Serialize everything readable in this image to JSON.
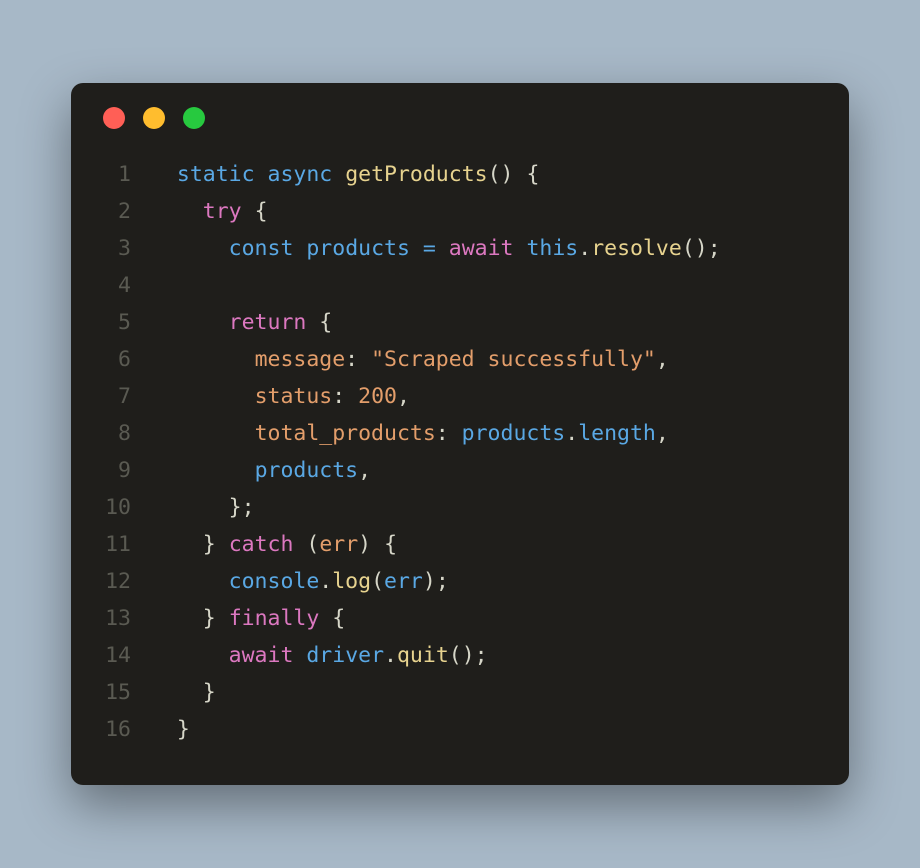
{
  "window": {
    "traffic_lights": [
      "red",
      "yellow",
      "green"
    ]
  },
  "code": {
    "lines": [
      {
        "n": "1",
        "tokens": [
          {
            "t": "  ",
            "c": "brace"
          },
          {
            "t": "static",
            "c": "kw-blue"
          },
          {
            "t": " ",
            "c": "brace"
          },
          {
            "t": "async",
            "c": "kw-blue"
          },
          {
            "t": " ",
            "c": "brace"
          },
          {
            "t": "getProducts",
            "c": "fn-name"
          },
          {
            "t": "()",
            "c": "punct"
          },
          {
            "t": " ",
            "c": "brace"
          },
          {
            "t": "{",
            "c": "brace"
          }
        ]
      },
      {
        "n": "2",
        "tokens": [
          {
            "t": "    ",
            "c": "brace"
          },
          {
            "t": "try",
            "c": "kw-try"
          },
          {
            "t": " ",
            "c": "brace"
          },
          {
            "t": "{",
            "c": "brace"
          }
        ]
      },
      {
        "n": "3",
        "tokens": [
          {
            "t": "      ",
            "c": "brace"
          },
          {
            "t": "const",
            "c": "kw-const"
          },
          {
            "t": " ",
            "c": "brace"
          },
          {
            "t": "products",
            "c": "ident"
          },
          {
            "t": " ",
            "c": "brace"
          },
          {
            "t": "=",
            "c": "op"
          },
          {
            "t": " ",
            "c": "brace"
          },
          {
            "t": "await",
            "c": "kw-await"
          },
          {
            "t": " ",
            "c": "brace"
          },
          {
            "t": "this",
            "c": "kw-this"
          },
          {
            "t": ".",
            "c": "punct"
          },
          {
            "t": "resolve",
            "c": "fn-call"
          },
          {
            "t": "();",
            "c": "punct"
          }
        ]
      },
      {
        "n": "4",
        "tokens": [
          {
            "t": "",
            "c": "brace"
          }
        ]
      },
      {
        "n": "5",
        "tokens": [
          {
            "t": "      ",
            "c": "brace"
          },
          {
            "t": "return",
            "c": "kw-return"
          },
          {
            "t": " ",
            "c": "brace"
          },
          {
            "t": "{",
            "c": "brace"
          }
        ]
      },
      {
        "n": "6",
        "tokens": [
          {
            "t": "        ",
            "c": "brace"
          },
          {
            "t": "message",
            "c": "prop"
          },
          {
            "t": ": ",
            "c": "punct"
          },
          {
            "t": "\"Scraped successfully\"",
            "c": "str"
          },
          {
            "t": ",",
            "c": "punct"
          }
        ]
      },
      {
        "n": "7",
        "tokens": [
          {
            "t": "        ",
            "c": "brace"
          },
          {
            "t": "status",
            "c": "prop"
          },
          {
            "t": ": ",
            "c": "punct"
          },
          {
            "t": "200",
            "c": "num"
          },
          {
            "t": ",",
            "c": "punct"
          }
        ]
      },
      {
        "n": "8",
        "tokens": [
          {
            "t": "        ",
            "c": "brace"
          },
          {
            "t": "total_products",
            "c": "prop"
          },
          {
            "t": ": ",
            "c": "punct"
          },
          {
            "t": "products",
            "c": "ident"
          },
          {
            "t": ".",
            "c": "punct"
          },
          {
            "t": "length",
            "c": "ident"
          },
          {
            "t": ",",
            "c": "punct"
          }
        ]
      },
      {
        "n": "9",
        "tokens": [
          {
            "t": "        ",
            "c": "brace"
          },
          {
            "t": "products",
            "c": "ident"
          },
          {
            "t": ",",
            "c": "punct"
          }
        ]
      },
      {
        "n": "10",
        "tokens": [
          {
            "t": "      ",
            "c": "brace"
          },
          {
            "t": "};",
            "c": "brace"
          }
        ]
      },
      {
        "n": "11",
        "tokens": [
          {
            "t": "    ",
            "c": "brace"
          },
          {
            "t": "}",
            "c": "brace"
          },
          {
            "t": " ",
            "c": "brace"
          },
          {
            "t": "catch",
            "c": "kw-catch"
          },
          {
            "t": " ",
            "c": "brace"
          },
          {
            "t": "(",
            "c": "punct"
          },
          {
            "t": "err",
            "c": "param"
          },
          {
            "t": ")",
            "c": "punct"
          },
          {
            "t": " ",
            "c": "brace"
          },
          {
            "t": "{",
            "c": "brace"
          }
        ]
      },
      {
        "n": "12",
        "tokens": [
          {
            "t": "      ",
            "c": "brace"
          },
          {
            "t": "console",
            "c": "ident"
          },
          {
            "t": ".",
            "c": "punct"
          },
          {
            "t": "log",
            "c": "fn-call"
          },
          {
            "t": "(",
            "c": "punct"
          },
          {
            "t": "err",
            "c": "ident"
          },
          {
            "t": ");",
            "c": "punct"
          }
        ]
      },
      {
        "n": "13",
        "tokens": [
          {
            "t": "    ",
            "c": "brace"
          },
          {
            "t": "}",
            "c": "brace"
          },
          {
            "t": " ",
            "c": "brace"
          },
          {
            "t": "finally",
            "c": "kw-finally"
          },
          {
            "t": " ",
            "c": "brace"
          },
          {
            "t": "{",
            "c": "brace"
          }
        ]
      },
      {
        "n": "14",
        "tokens": [
          {
            "t": "      ",
            "c": "brace"
          },
          {
            "t": "await",
            "c": "kw-await"
          },
          {
            "t": " ",
            "c": "brace"
          },
          {
            "t": "driver",
            "c": "ident"
          },
          {
            "t": ".",
            "c": "punct"
          },
          {
            "t": "quit",
            "c": "fn-call"
          },
          {
            "t": "();",
            "c": "punct"
          }
        ]
      },
      {
        "n": "15",
        "tokens": [
          {
            "t": "    ",
            "c": "brace"
          },
          {
            "t": "}",
            "c": "brace"
          }
        ]
      },
      {
        "n": "16",
        "tokens": [
          {
            "t": "  ",
            "c": "brace"
          },
          {
            "t": "}",
            "c": "brace"
          }
        ]
      }
    ]
  }
}
